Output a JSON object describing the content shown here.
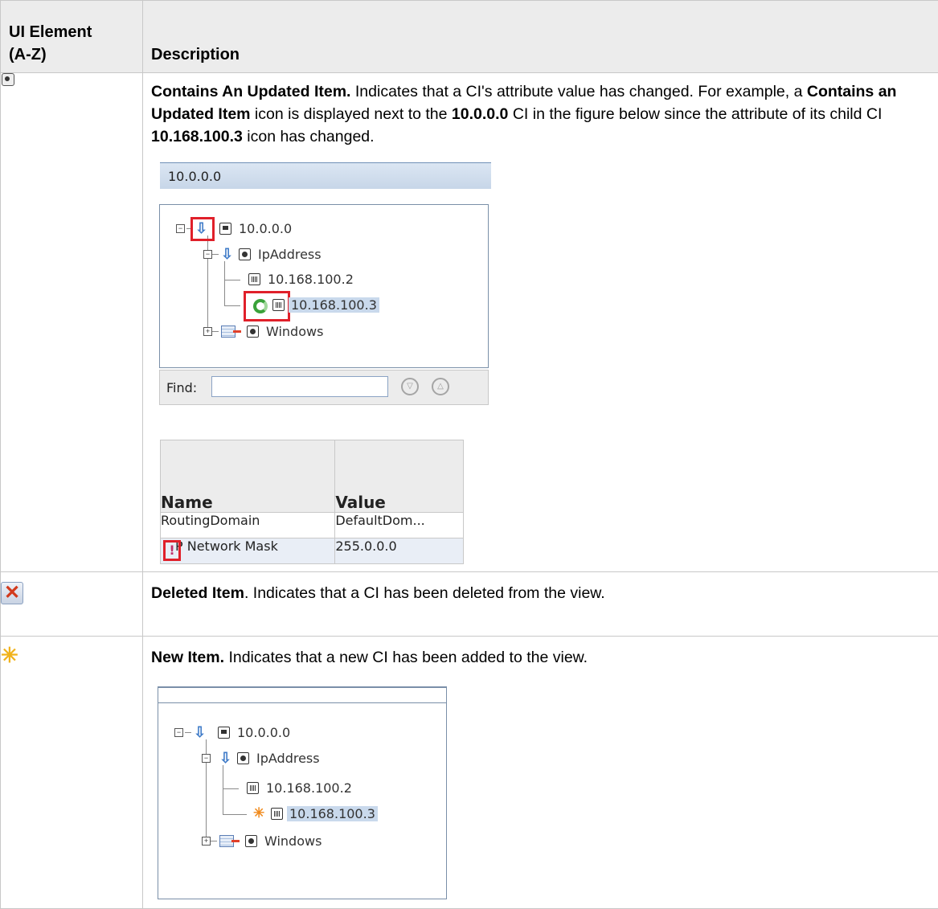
{
  "header": {
    "col1_line1": "UI Element",
    "col1_line2": "(A-Z)",
    "col2": "Description"
  },
  "rows": [
    {
      "icon": "contains-updated-item-icon",
      "title": "Contains An Updated Item.",
      "text1": " Indicates that a CI's attribute value has changed. For example, a ",
      "bold1": "Contains an Updated Item",
      "text2": " icon is displayed next to the ",
      "bold2": "10.0.0.0",
      "text3": " CI in the figure below since the attribute of its child CI ",
      "bold3": "10.168.100.3",
      "text4": " icon has changed."
    },
    {
      "icon": "deleted-item-icon",
      "title": "Deleted Item",
      "text1": ". Indicates that a CI has been deleted from the view."
    },
    {
      "icon": "new-item-icon",
      "title": "New Item.",
      "text1": " Indicates that a new CI has been added to the view."
    }
  ],
  "figure1": {
    "bar_title": "10.0.0.0",
    "tree": {
      "root": "10.0.0.0",
      "child": "IpAddress",
      "leaf1": "10.168.100.2",
      "leaf2": "10.168.100.3",
      "sibling": "Windows"
    },
    "find_label": "Find:",
    "find_value": "",
    "props": {
      "col_name": "Name",
      "col_value": "Value",
      "rows": [
        {
          "name": "RoutingDomain",
          "value": "DefaultDom..."
        },
        {
          "name": "P Network Mask",
          "value": "255.0.0.0"
        }
      ]
    }
  },
  "figure2": {
    "tree": {
      "root": "10.0.0.0",
      "child": "IpAddress",
      "leaf1": "10.168.100.2",
      "leaf2": "10.168.100.3",
      "sibling": "Windows"
    }
  }
}
